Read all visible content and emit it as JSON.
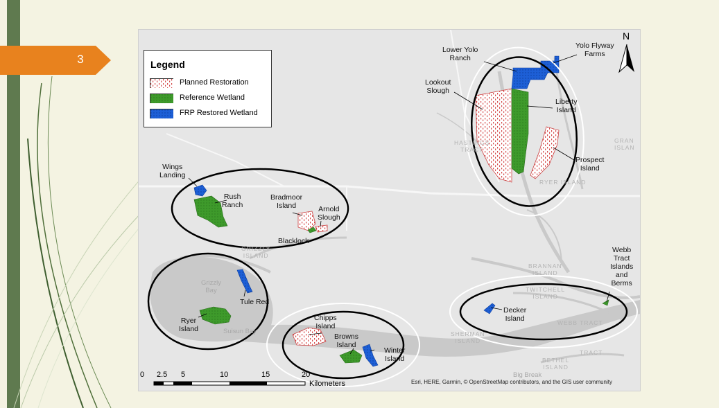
{
  "slide": {
    "number": "3",
    "colors": {
      "background": "#f4f3e2",
      "accent_bar": "#5f7a4f",
      "number_tab": "#e8821e"
    }
  },
  "legend": {
    "title": "Legend",
    "items": [
      {
        "label": "Planned Restoration",
        "pattern": "red-dotted"
      },
      {
        "label": "Reference Wetland",
        "color": "#3e9a2b"
      },
      {
        "label": "FRP Restored Wetland",
        "color": "#1d5fd6"
      }
    ]
  },
  "north_arrow": {
    "label": "N"
  },
  "map_labels": {
    "wings_landing": "Wings\nLanding",
    "rush_ranch": "Rush\nRanch",
    "bradmoor_island": "Bradmoor\nIsland",
    "arnold_slough": "Arnold\nSlough",
    "blacklock": "Blacklock",
    "tule_red": "Tule Red",
    "ryer_island": "Ryer\nIsland",
    "chipps_island": "Chipps\nIsland",
    "browns_island": "Browns\nIsland",
    "winter_island": "Winter\nIsland",
    "decker_island": "Decker\nIsland",
    "webb_tract_islands": "Webb\nTract\nIslands\nand\nBerms",
    "lower_yolo_ranch": "Lower Yolo\nRanch",
    "yolo_flyway_farms": "Yolo Flyway\nFarms",
    "lookout_slough": "Lookout\nSlough",
    "liberty_island": "Liberty\nIsland",
    "prospect_island": "Prospect\nIsland"
  },
  "basemap_labels": {
    "grizzly_island": "GRIZZLY\nISLAND",
    "grizzly_bay": "Grizzly\nBay",
    "suisun_bay": "Suisun Bay",
    "hastings_tract": "HASTINGS\nTRACT",
    "ryer_island_upper": "RYER ISLAND",
    "grand_island": "GRAN\nISLAN",
    "brannan_island": "BRANNAN\nISLAND",
    "twitchell_island": "TWITCHELL\nISLAND",
    "webb_tract": "WEBB TRACT",
    "sherman_island": "SHERMAN\nISLAND",
    "bethel_island": "BETHEL\nISLAND",
    "bradford_tract": "TRACT",
    "big_break": "Big Break"
  },
  "scale_bar": {
    "ticks": [
      "0",
      "2.5",
      "5",
      "10",
      "15",
      "20"
    ],
    "unit": "Kilometers"
  },
  "attribution": "Esri, HERE, Garmin, © OpenStreetMap contributors, and the GIS user community"
}
